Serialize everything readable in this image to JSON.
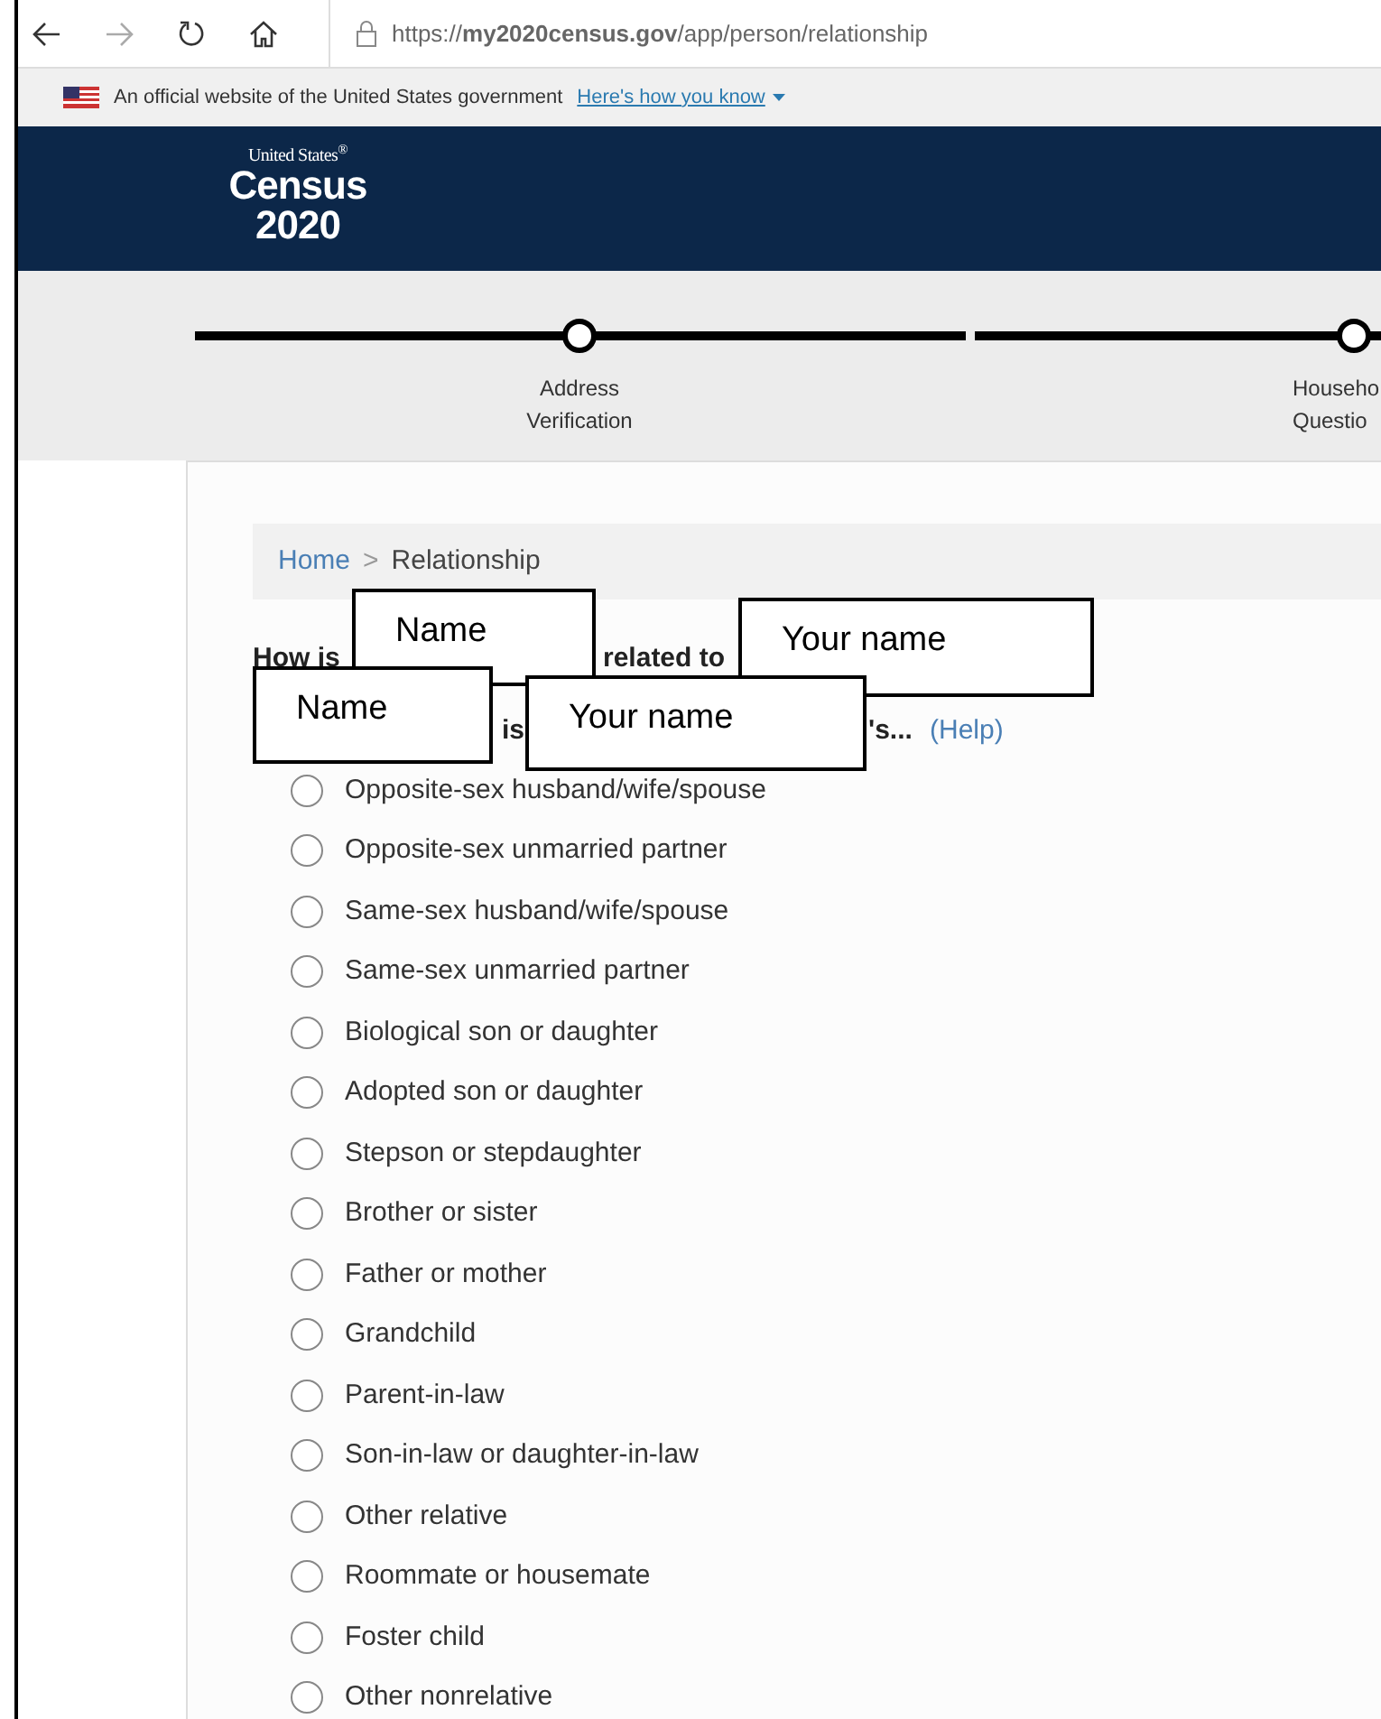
{
  "browser": {
    "url": "https://**my2020census.gov**/app/person/relationship"
  },
  "gov_banner": {
    "text": "An official website of the United States government",
    "link": "Here's how you know"
  },
  "logo": {
    "line_1": "United States$^{®}$",
    "line_2": "Census",
    "line_3": "2020"
  },
  "progress_steps": [
    {
      "label_1": "Address",
      "label_2": "Verification"
    },
    {
      "label_1": "Househo",
      "label_2": "Questio"
    }
  ],
  "breadcrumb": {
    "items": [
      {
        "label": "Home",
        "kind": "link"
      },
      {
        "label": "Relationship",
        "kind": "current"
      }
    ],
    "separator": ">"
  },
  "question": {
    "line_1": [
      "How is",
      "related to"
    ],
    "line_2": [
      "is",
      "'s..."
    ],
    "help_link": "(Help)"
  },
  "overlays": [
    {
      "text": "Name"
    },
    {
      "text": "Your name"
    },
    {
      "text": "Name"
    },
    {
      "text": "Your name"
    }
  ],
  "options": [
    {
      "label": "Opposite-sex husband/wife/spouse",
      "selected": false
    },
    {
      "label": "Opposite-sex unmarried partner",
      "selected": false
    },
    {
      "label": "Same-sex husband/wife/spouse",
      "selected": false
    },
    {
      "label": "Same-sex unmarried partner",
      "selected": false
    },
    {
      "label": "Biological son or daughter",
      "selected": false
    },
    {
      "label": "Adopted son or daughter",
      "selected": false
    },
    {
      "label": "Stepson or stepdaughter",
      "selected": false
    },
    {
      "label": "Brother or sister",
      "selected": false
    },
    {
      "label": "Father or mother",
      "selected": false
    },
    {
      "label": "Grandchild",
      "selected": false
    },
    {
      "label": "Parent-in-law",
      "selected": false
    },
    {
      "label": "Son-in-law or daughter-in-law",
      "selected": false
    },
    {
      "label": "Other relative",
      "selected": false
    },
    {
      "label": "Roommate or housemate",
      "selected": false
    },
    {
      "label": "Foster child",
      "selected": false
    },
    {
      "label": "Other nonrelative",
      "selected": false
    }
  ]
}
